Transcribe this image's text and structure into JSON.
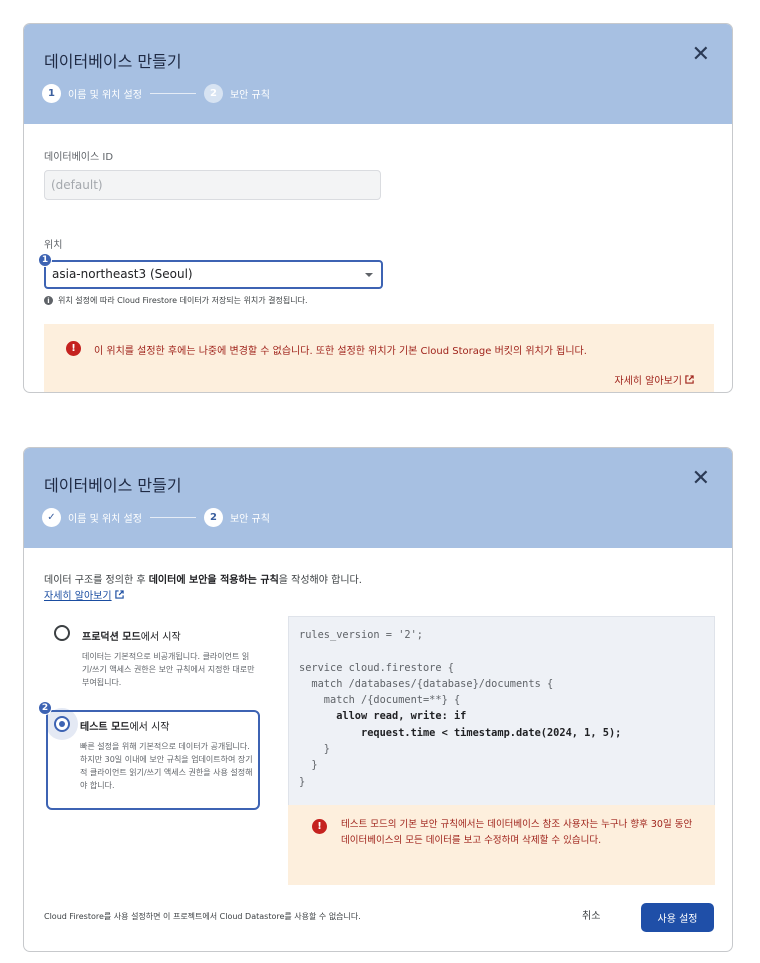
{
  "dialog1": {
    "title": "데이터베이스 만들기",
    "close_glyph": "✕",
    "steps": [
      {
        "number": "1",
        "label": "이름 및 위치 설정"
      },
      {
        "number": "2",
        "label": "보안 규칙"
      }
    ],
    "database_id": {
      "label": "데이터베이스 ID",
      "placeholder": "(default)"
    },
    "location": {
      "label": "위치",
      "selected": "asia-northeast3 (Seoul)",
      "callout_badge": "1",
      "help_text": "위치 설정에 따라 Cloud Firestore 데이터가 저장되는 위치가 결정됩니다."
    },
    "warning": {
      "text": "이 위치를 설정한 후에는 나중에 변경할 수 없습니다. 또한 설정한 위치가 기본 Cloud Storage 버킷의 위치가 됩니다.",
      "learn_more": "자세히 알아보기"
    }
  },
  "dialog2": {
    "title": "데이터베이스 만들기",
    "close_glyph": "✕",
    "steps": [
      {
        "number": "✓",
        "label": "이름 및 위치 설정"
      },
      {
        "number": "2",
        "label": "보안 규칙"
      }
    ],
    "intro_prefix": "데이터 구조를 정의한 후 ",
    "intro_bold": "데이터에 보안을 적용하는 규칙",
    "intro_suffix": "을 작성해야 합니다.",
    "learn_more": "자세히 알아보기",
    "production_mode": {
      "title_bold": "프로덕션 모드",
      "title_rest": "에서 시작",
      "description": "데이터는 기본적으로 비공개됩니다. 클라이언트 읽기/쓰기 액세스 권한은 보안 규칙에서 지정한 대로만 부여됩니다."
    },
    "test_mode": {
      "title_bold": "테스트 모드",
      "title_rest": "에서 시작",
      "description": "빠른 설정을 위해 기본적으로 데이터가 공개됩니다. 하지만 30일 이내에 보안 규칙을 업데이트하여 장기적 클라이언트 읽기/쓰기 액세스 권한을 사용 설정해야 합니다.",
      "callout_badge": "2"
    },
    "rules_code": {
      "line1": "rules_version = '2';",
      "line2": "",
      "line3": "service cloud.firestore {",
      "line4": "  match /databases/{database}/documents {",
      "line5": "    match /{document=**} {",
      "line6": "      allow read, write: if",
      "line7": "          request.time < timestamp.date(2024, 1, 5);",
      "line8": "    }",
      "line9": "  }",
      "line10": "}"
    },
    "rules_warning": "테스트 모드의 기본 보안 규칙에서는 데이터베이스 참조 사용자는 누구나 향후 30일 동안 데이터베이스의 모든 데이터를 보고 수정하며 삭제할 수 있습니다.",
    "footer_note": "Cloud Firestore를 사용 설정하면 이 프로젝트에서 Cloud Datastore를 사용할 수 없습니다.",
    "cancel_label": "취소",
    "enable_label": "사용 설정"
  },
  "colors": {
    "header_bg": "#a7c0e2",
    "accent": "#3d63b3",
    "warning_bg": "#fdefdd",
    "warning_text": "#a0241c",
    "primary_button": "#1f4fa8"
  }
}
